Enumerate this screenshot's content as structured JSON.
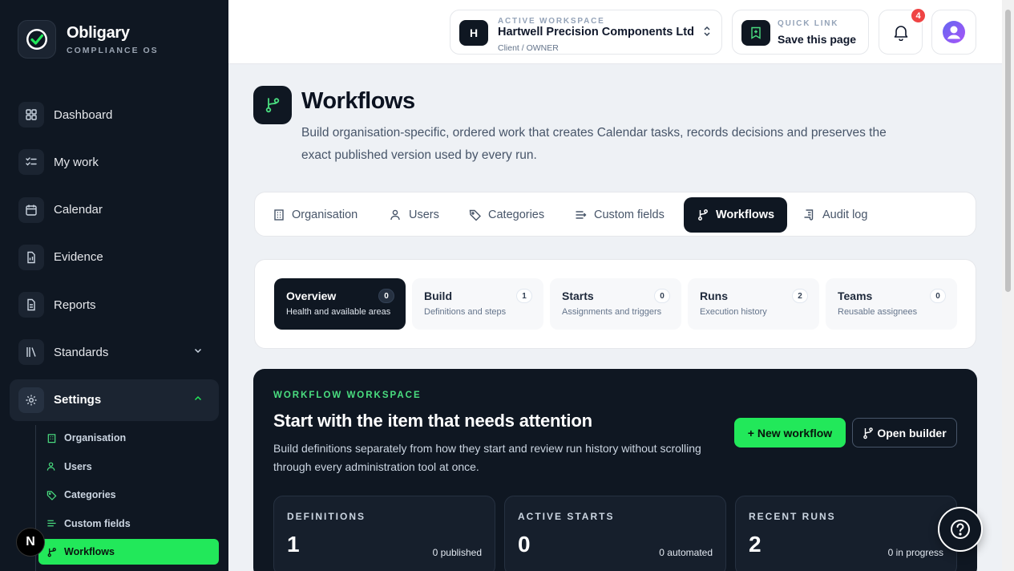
{
  "brand": {
    "name": "Obligary",
    "subtitle": "COMPLIANCE OS"
  },
  "sidebar": {
    "items": [
      {
        "label": "Dashboard",
        "icon": "grid-icon"
      },
      {
        "label": "My work",
        "icon": "checklist-icon"
      },
      {
        "label": "Calendar",
        "icon": "calendar-icon"
      },
      {
        "label": "Evidence",
        "icon": "file-icon"
      },
      {
        "label": "Reports",
        "icon": "document-icon"
      },
      {
        "label": "Standards",
        "icon": "books-icon"
      },
      {
        "label": "Settings",
        "icon": "gear-icon"
      }
    ],
    "settings_sub": [
      {
        "label": "Organisation",
        "icon": "building-icon"
      },
      {
        "label": "Users",
        "icon": "users-icon"
      },
      {
        "label": "Categories",
        "icon": "tag-icon"
      },
      {
        "label": "Custom fields",
        "icon": "list-icon"
      },
      {
        "label": "Workflows",
        "icon": "workflow-icon"
      }
    ],
    "n_badge": "N"
  },
  "workspace": {
    "label": "ACTIVE WORKSPACE",
    "initial": "H",
    "name": "Hartwell Precision Components Ltd",
    "role": "Client  /  OWNER"
  },
  "quick_link": {
    "label": "QUICK LINK",
    "text": "Save this page"
  },
  "notifications": {
    "count": "4"
  },
  "page": {
    "title": "Workflows",
    "description": "Build organisation-specific, ordered work that creates Calendar tasks, records decisions and preserves the exact published version used by every run."
  },
  "tabs": [
    {
      "label": "Organisation"
    },
    {
      "label": "Users"
    },
    {
      "label": "Categories"
    },
    {
      "label": "Custom fields"
    },
    {
      "label": "Workflows"
    },
    {
      "label": "Audit log"
    }
  ],
  "steps": [
    {
      "title": "Overview",
      "sub": "Health and available areas",
      "count": "0"
    },
    {
      "title": "Build",
      "sub": "Definitions and steps",
      "count": "1"
    },
    {
      "title": "Starts",
      "sub": "Assignments and triggers",
      "count": "0"
    },
    {
      "title": "Runs",
      "sub": "Execution history",
      "count": "2"
    },
    {
      "title": "Teams",
      "sub": "Reusable assignees",
      "count": "0"
    }
  ],
  "workspace_panel": {
    "eyebrow": "WORKFLOW WORKSPACE",
    "title": "Start with the item that needs attention",
    "description": "Build definitions separately from how they start and review run history without scrolling through every administration tool at once.",
    "new_button": "+ New workflow",
    "open_button": "Open builder",
    "stats": [
      {
        "label": "DEFINITIONS",
        "value": "1",
        "sub": "0 published"
      },
      {
        "label": "ACTIVE STARTS",
        "value": "0",
        "sub": "0 automated"
      },
      {
        "label": "RECENT RUNS",
        "value": "2",
        "sub": "0 in progress"
      }
    ]
  },
  "colors": {
    "accent": "#22e85a",
    "dark": "#0f1722",
    "badge": "#ef4444"
  }
}
